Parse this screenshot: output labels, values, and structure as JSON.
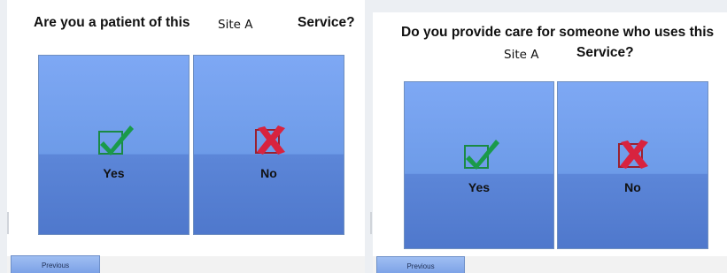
{
  "left_screen": {
    "question_part1": "Are you a patient of this",
    "site": "Site A",
    "question_part2": "Service?",
    "yes_label": "Yes",
    "no_label": "No",
    "previous_label": "Previous"
  },
  "right_screen": {
    "question_line1": "Do you provide care for someone who uses this",
    "site": "Site A",
    "question_part2": "Service?",
    "yes_label": "Yes",
    "no_label": "No",
    "previous_label": "Previous"
  },
  "icons": {
    "yes": "green-checkmark-icon",
    "no": "red-x-icon"
  },
  "colors": {
    "button_blue": "#6d9be8",
    "check_green": "#1a9a4a",
    "x_red": "#d8233f"
  }
}
